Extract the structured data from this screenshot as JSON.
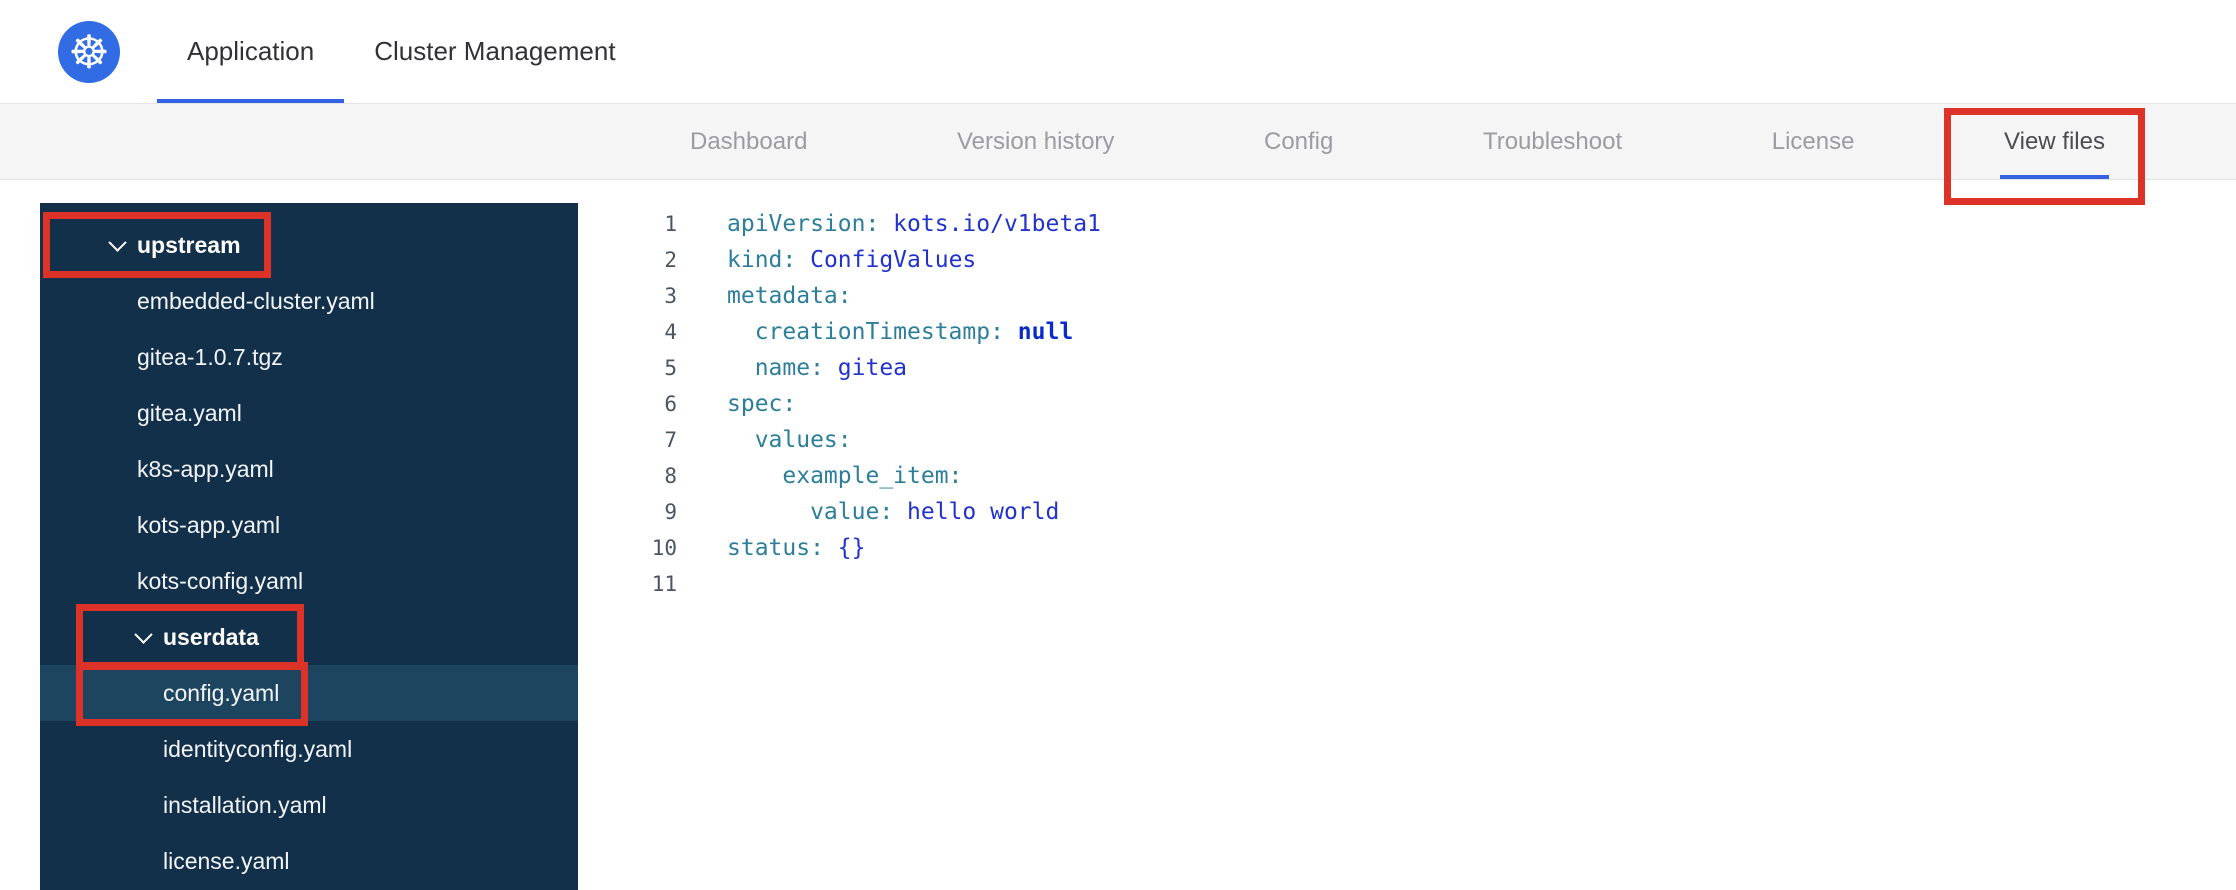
{
  "header": {
    "logo_glyph": "☸",
    "tabs": [
      {
        "label": "Application"
      },
      {
        "label": "Cluster Management"
      }
    ],
    "active_tab": "Application"
  },
  "subnav": {
    "tabs": [
      "Dashboard",
      "Version history",
      "Config",
      "Troubleshoot",
      "License",
      "View files"
    ],
    "active_tab": "View files"
  },
  "sidebar": {
    "items": [
      {
        "label": "upstream",
        "type": "folder",
        "depth": 0,
        "expanded": true
      },
      {
        "label": "embedded-cluster.yaml",
        "type": "file",
        "depth": 1
      },
      {
        "label": "gitea-1.0.7.tgz",
        "type": "file",
        "depth": 1
      },
      {
        "label": "gitea.yaml",
        "type": "file",
        "depth": 1
      },
      {
        "label": "k8s-app.yaml",
        "type": "file",
        "depth": 1
      },
      {
        "label": "kots-app.yaml",
        "type": "file",
        "depth": 1
      },
      {
        "label": "kots-config.yaml",
        "type": "file",
        "depth": 1
      },
      {
        "label": "userdata",
        "type": "folder",
        "depth": 1,
        "expanded": true
      },
      {
        "label": "config.yaml",
        "type": "file",
        "depth": 2,
        "selected": true
      },
      {
        "label": "identityconfig.yaml",
        "type": "file",
        "depth": 2
      },
      {
        "label": "installation.yaml",
        "type": "file",
        "depth": 2
      },
      {
        "label": "license.yaml",
        "type": "file",
        "depth": 2
      }
    ]
  },
  "editor": {
    "lines": [
      {
        "number": 1,
        "tokens": [
          {
            "type": "key",
            "text": "apiVersion:"
          },
          {
            "type": "value",
            "text": " kots.io/v1beta1"
          }
        ]
      },
      {
        "number": 2,
        "tokens": [
          {
            "type": "key",
            "text": "kind:"
          },
          {
            "type": "value",
            "text": " ConfigValues"
          }
        ]
      },
      {
        "number": 3,
        "tokens": [
          {
            "type": "key",
            "text": "metadata:"
          }
        ]
      },
      {
        "number": 4,
        "tokens": [
          {
            "type": "key",
            "text": "  creationTimestamp:"
          },
          {
            "type": "null",
            "text": " null"
          }
        ]
      },
      {
        "number": 5,
        "tokens": [
          {
            "type": "key",
            "text": "  name:"
          },
          {
            "type": "value",
            "text": " gitea"
          }
        ]
      },
      {
        "number": 6,
        "tokens": [
          {
            "type": "key",
            "text": "spec:"
          }
        ]
      },
      {
        "number": 7,
        "tokens": [
          {
            "type": "key",
            "text": "  values:"
          }
        ]
      },
      {
        "number": 8,
        "tokens": [
          {
            "type": "key",
            "text": "    example_item:"
          }
        ]
      },
      {
        "number": 9,
        "tokens": [
          {
            "type": "key",
            "text": "      value:"
          },
          {
            "type": "value",
            "text": " hello world"
          }
        ]
      },
      {
        "number": 10,
        "tokens": [
          {
            "type": "key",
            "text": "status:"
          },
          {
            "type": "value",
            "text": " {}"
          }
        ]
      },
      {
        "number": 11,
        "tokens": []
      }
    ]
  },
  "annotations": {
    "targets": [
      "View files tab",
      "upstream folder",
      "userdata folder",
      "config.yaml file"
    ]
  },
  "colors": {
    "accent_blue": "#3562e3",
    "logo_blue": "#326ce5",
    "sidebar_bg": "#13304a",
    "sidebar_selected": "#1e4560",
    "code_key": "#2d7e9a",
    "code_value": "#2233cb",
    "annotation_red": "#dc3227"
  }
}
